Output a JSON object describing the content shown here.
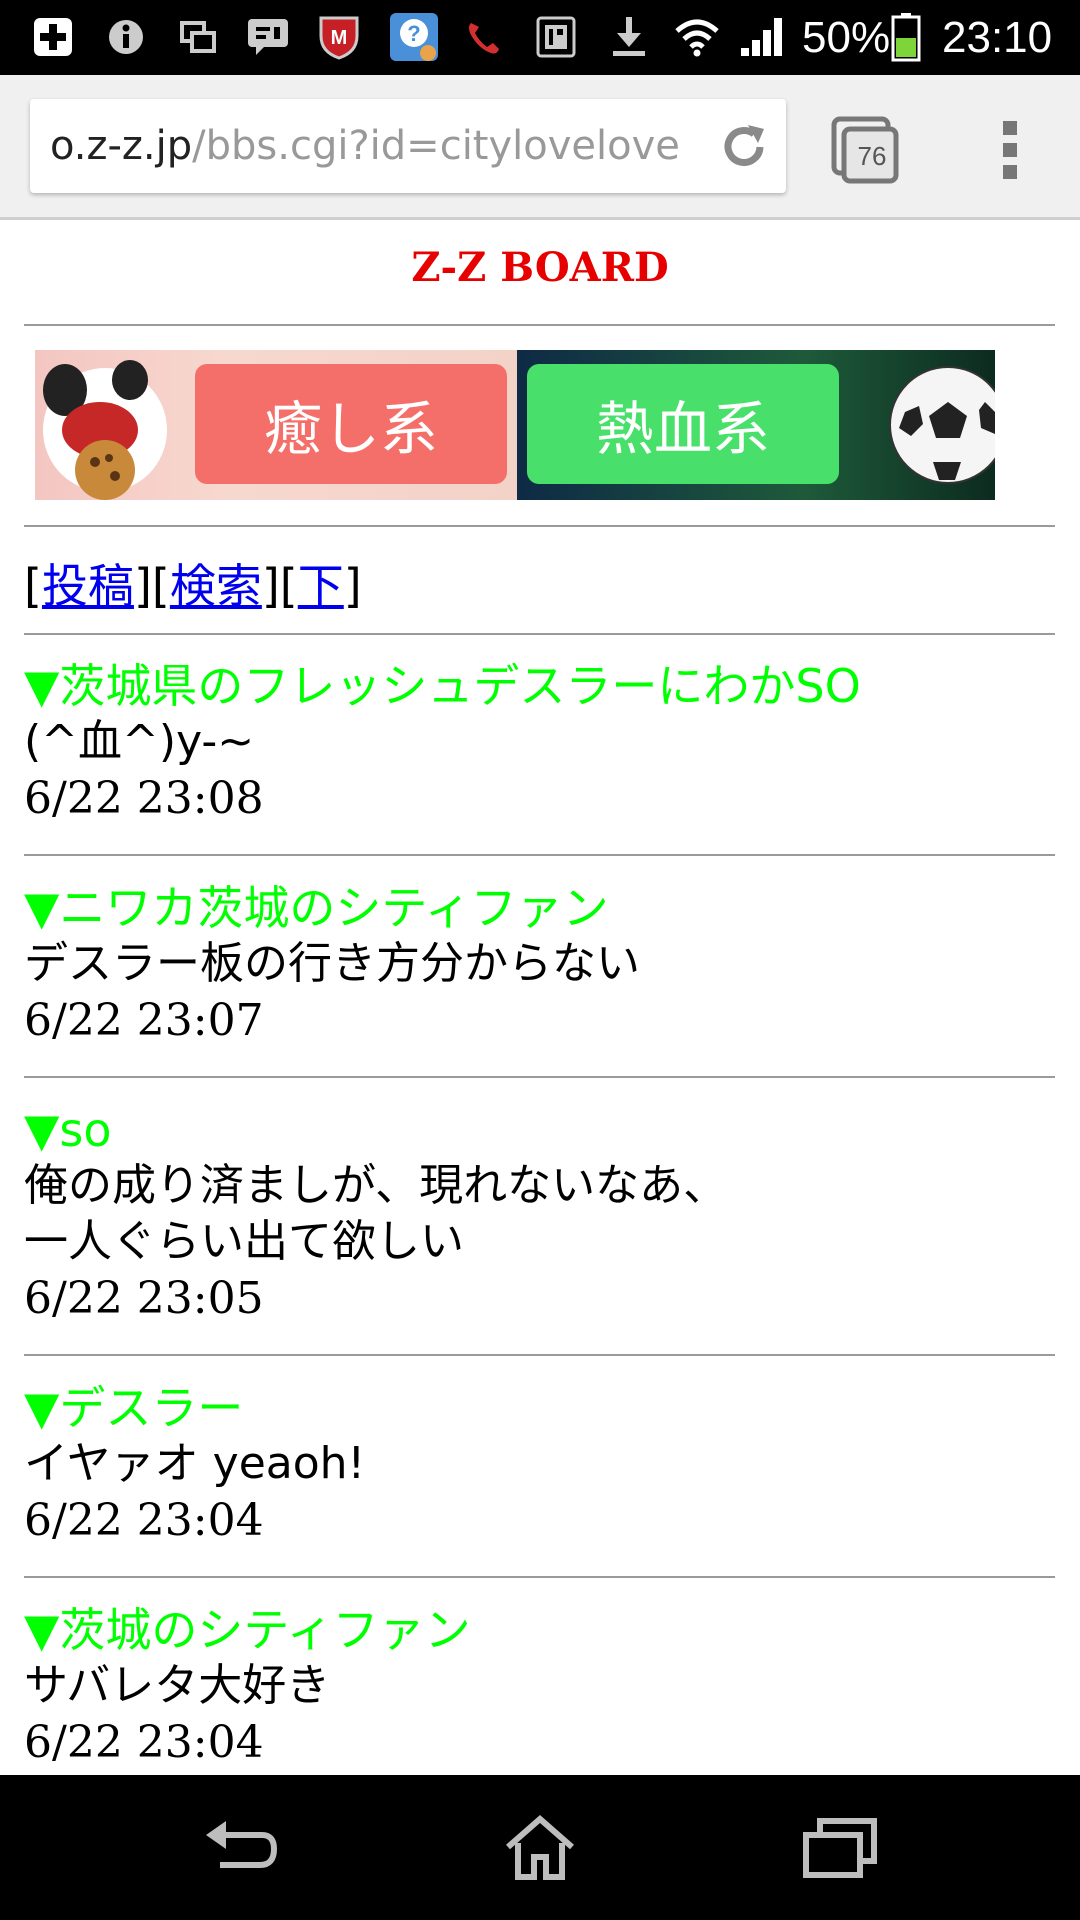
{
  "status_bar": {
    "battery_percent": "50%",
    "time": "23:10",
    "icons": [
      "add-icon",
      "info-icon",
      "windows-icon",
      "message-icon",
      "mcafee-icon",
      "help-sticker-icon",
      "missed-call-icon",
      "sim-toolkit-icon",
      "download-icon",
      "wifi-icon",
      "signal-icon",
      "battery-icon"
    ]
  },
  "browser": {
    "url_host": "o.z-z.jp",
    "url_path": "/bbs.cgi?id=citylovelove",
    "tab_count": "76"
  },
  "page": {
    "title": "Z-Z BOARD",
    "banner": {
      "left_label": "癒し系",
      "right_label": "熱血系"
    },
    "nav": {
      "open1": "[",
      "post": "投稿",
      "mid1": "][",
      "search": "検索",
      "mid2": "][",
      "down": "下",
      "close": "]"
    },
    "posts": [
      {
        "title": "茨城県のフレッシュデスラーにわかSO",
        "body": [
          "(^血^)y-~"
        ],
        "date": "6/22 23:08"
      },
      {
        "title": "ニワカ茨城のシティファン",
        "body": [
          "デスラー板の行き方分からない"
        ],
        "date": "6/22 23:07"
      },
      {
        "title": "so",
        "body": [
          "俺の成り済ましが、現れないなあ、",
          "一人ぐらい出て欲しい"
        ],
        "date": "6/22 23:05"
      },
      {
        "title": "デスラー",
        "body": [
          "イヤァオ yeaoh!"
        ],
        "date": "6/22 23:04"
      },
      {
        "title": "茨城のシティファン",
        "body": [
          "サバレタ大好き"
        ],
        "date": "6/22 23:04"
      }
    ],
    "triangle": "▼"
  },
  "colors": {
    "title_red": "#e60000",
    "post_title_green": "#00ff00",
    "link_blue": "#0000ee"
  }
}
